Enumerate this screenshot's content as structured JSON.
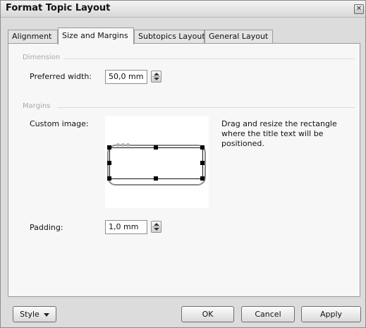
{
  "window": {
    "title": "Format Topic Layout",
    "close_glyph": "✕"
  },
  "tabs": [
    {
      "label": "Alignment",
      "active": false
    },
    {
      "label": "Size and Margins",
      "active": true
    },
    {
      "label": "Subtopics Layout",
      "active": false
    },
    {
      "label": "General Layout",
      "active": false
    }
  ],
  "dimension": {
    "group_label": "Dimension",
    "preferred_width_label": "Preferred width:",
    "preferred_width_value": "50,0 mm"
  },
  "margins": {
    "group_label": "Margins",
    "custom_image_label": "Custom image:",
    "hint": "Drag and resize the rectangle where the title text will be positioned.",
    "padding_label": "Padding:",
    "padding_value": "1,0 mm"
  },
  "footer": {
    "style_label": "Style",
    "ok_label": "OK",
    "cancel_label": "Cancel",
    "apply_label": "Apply"
  },
  "icons": {
    "close": "close-icon",
    "spin_up": "arrow-up-icon",
    "spin_down": "arrow-down-icon",
    "dropdown": "chevron-down-icon"
  }
}
